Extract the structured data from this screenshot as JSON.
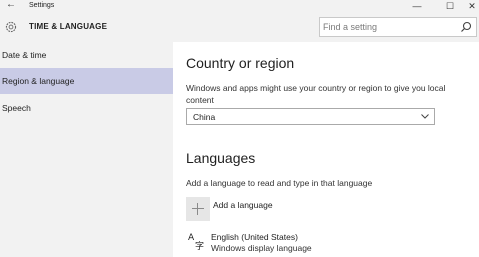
{
  "window": {
    "title": "Settings",
    "back_glyph": "←",
    "minimize_glyph": "—",
    "maximize_glyph": "☐",
    "close_glyph": "✕"
  },
  "header": {
    "icon": "gear-icon",
    "section_title": "TIME & LANGUAGE",
    "search_placeholder": "Find a setting",
    "search_icon": "search-icon"
  },
  "sidebar": {
    "items": [
      {
        "label": "Date & time",
        "selected": false
      },
      {
        "label": "Region & language",
        "selected": true
      },
      {
        "label": "Speech",
        "selected": false
      }
    ],
    "selected_color": "#c9cbe6"
  },
  "main": {
    "region": {
      "heading": "Country or region",
      "description": "Windows and apps might use your country or region to give you local content",
      "selected_country": "China"
    },
    "languages": {
      "heading": "Languages",
      "description": "Add a language to read and type in that language",
      "add_label": "Add a language",
      "list": [
        {
          "name": "English (United States)",
          "subtitle": "Windows display language",
          "icon": "language-icon"
        }
      ]
    }
  }
}
